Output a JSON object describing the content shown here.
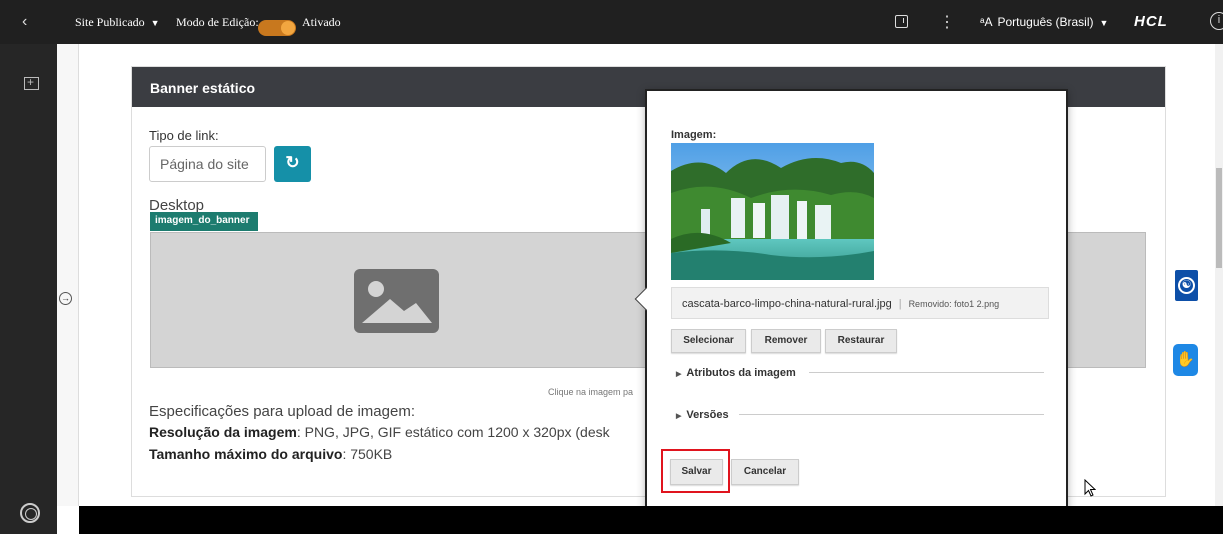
{
  "topbar": {
    "back_icon": "chevron-left-icon",
    "site_status": "Site Publicado",
    "edit_mode_label": "Modo de Edição:",
    "edit_mode_value": "Ativado",
    "edit_mode_on": true,
    "language": "Português (Brasil)",
    "brand": "HCL"
  },
  "banner": {
    "title": "Banner estático",
    "link_type_label": "Tipo de link:",
    "link_type_value": "Página do site",
    "desktop_label": "Desktop",
    "field_tag": "imagem_do_banner",
    "click_hint": "Clique na imagem pa",
    "specs_title": "Especificações para upload de imagem:",
    "resolution_label": "Resolução da imagem",
    "resolution_value": ": PNG, JPG, GIF estático com 1200 x 320px (desk",
    "max_size_label": "Tamanho máximo do arquivo",
    "max_size_value": ": 750KB"
  },
  "popover": {
    "image_label": "Imagem:",
    "file_name": "cascata-barco-limpo-china-natural-rural.jpg",
    "removed_label": "Removido: foto1 2.png",
    "buttons": {
      "select": "Selecionar",
      "remove": "Remover",
      "restore": "Restaurar"
    },
    "sections": {
      "attributes": "Atributos da imagem",
      "versions": "Versões"
    },
    "save": "Salvar",
    "cancel": "Cancelar"
  },
  "colors": {
    "topbar": "#202020",
    "toggle": "#c8781e",
    "card_header": "#3b3d42",
    "refresh_button": "#1590a8",
    "field_tag": "#1d7c6f",
    "highlight": "#e0141e",
    "accessibility": "#0d4fa8"
  }
}
